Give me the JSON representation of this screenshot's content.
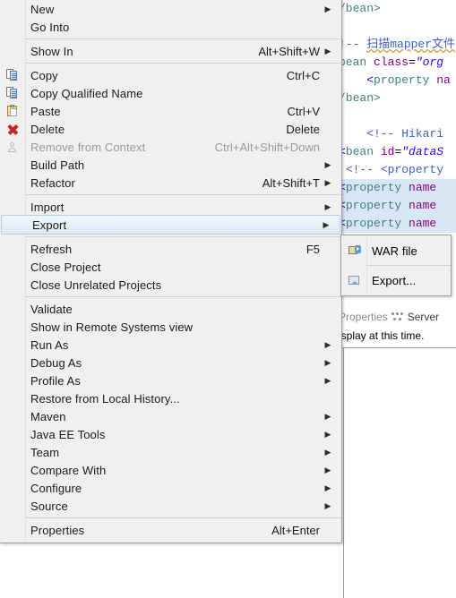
{
  "app": "eclipse-ide",
  "editor": {
    "lines": [
      {
        "selected": false,
        "html": "tag:/bean>"
      },
      {
        "selected": false,
        "html": ""
      },
      {
        "selected": false,
        "html": "cmt:!-- |cjk:扫描mapper文件"
      },
      {
        "selected": false,
        "html": "tag:bean |attr:class|plain:=|val:\"org"
      },
      {
        "selected": false,
        "html": "pad4|br:<|tag:property |attr:na"
      },
      {
        "selected": false,
        "html": "tag:/bean>"
      },
      {
        "selected": false,
        "html": ""
      },
      {
        "selected": false,
        "html": "pad4|cmt:<!-- Hikari "
      },
      {
        "selected": false,
        "html": "br:<|tag:bean |attr:id|plain:=|val:\"dataS"
      },
      {
        "selected": false,
        "html": "pad1|cmt:<!-- <property"
      },
      {
        "selected": true,
        "html": "br:<|tag:property |attr:name"
      },
      {
        "selected": true,
        "html": "br:<|tag:property |attr:name"
      },
      {
        "selected": true,
        "html": "br:<|tag:property |attr:name"
      }
    ],
    "code_text": [
      "/bean>",
      "",
      "!-- 扫描mapper文件",
      "bean class=\"org",
      "    <property na",
      "/bean>",
      "",
      "    <!-- Hikari ",
      "<bean id=\"dataS",
      " <!-- <property",
      "<property name",
      "<property name",
      "<property name"
    ]
  },
  "bottom_panel": {
    "tabs": [
      {
        "label": "Properties",
        "icon": "properties-icon",
        "active": false
      },
      {
        "label": "Server",
        "icon": "servers-icon",
        "active": true
      }
    ],
    "message": "isplay at this time."
  },
  "context_menu": {
    "groups": [
      {
        "items": [
          {
            "label": "New",
            "accel": "",
            "submenu": true,
            "icon": "",
            "disabled": false
          },
          {
            "label": "Go Into",
            "accel": "",
            "submenu": false,
            "icon": "",
            "disabled": false
          }
        ]
      },
      {
        "items": [
          {
            "label": "Show In",
            "accel": "Alt+Shift+W",
            "submenu": true,
            "icon": "",
            "disabled": false
          }
        ]
      },
      {
        "items": [
          {
            "label": "Copy",
            "accel": "Ctrl+C",
            "submenu": false,
            "icon": "copy-icon",
            "disabled": false
          },
          {
            "label": "Copy Qualified Name",
            "accel": "",
            "submenu": false,
            "icon": "copy-icon",
            "disabled": false
          },
          {
            "label": "Paste",
            "accel": "Ctrl+V",
            "submenu": false,
            "icon": "paste-icon",
            "disabled": false
          },
          {
            "label": "Delete",
            "accel": "Delete",
            "submenu": false,
            "icon": "delete-icon",
            "disabled": false
          },
          {
            "label": "Remove from Context",
            "accel": "Ctrl+Alt+Shift+Down",
            "submenu": false,
            "icon": "remove-from-context-icon",
            "disabled": true
          },
          {
            "label": "Build Path",
            "accel": "",
            "submenu": true,
            "icon": "",
            "disabled": false
          },
          {
            "label": "Refactor",
            "accel": "Alt+Shift+T",
            "submenu": true,
            "icon": "",
            "disabled": false
          }
        ]
      },
      {
        "items": [
          {
            "label": "Import",
            "accel": "",
            "submenu": true,
            "icon": "",
            "disabled": false,
            "selected": false
          },
          {
            "label": "Export",
            "accel": "",
            "submenu": true,
            "icon": "",
            "disabled": false,
            "selected": true
          }
        ]
      },
      {
        "items": [
          {
            "label": "Refresh",
            "accel": "F5",
            "submenu": false,
            "icon": "",
            "disabled": false
          },
          {
            "label": "Close Project",
            "accel": "",
            "submenu": false,
            "icon": "",
            "disabled": false
          },
          {
            "label": "Close Unrelated Projects",
            "accel": "",
            "submenu": false,
            "icon": "",
            "disabled": false
          }
        ]
      },
      {
        "items": [
          {
            "label": "Validate",
            "accel": "",
            "submenu": false,
            "icon": "",
            "disabled": false
          },
          {
            "label": "Show in Remote Systems view",
            "accel": "",
            "submenu": false,
            "icon": "",
            "disabled": false
          },
          {
            "label": "Run As",
            "accel": "",
            "submenu": true,
            "icon": "",
            "disabled": false
          },
          {
            "label": "Debug As",
            "accel": "",
            "submenu": true,
            "icon": "",
            "disabled": false
          },
          {
            "label": "Profile As",
            "accel": "",
            "submenu": true,
            "icon": "",
            "disabled": false
          },
          {
            "label": "Restore from Local History...",
            "accel": "",
            "submenu": false,
            "icon": "",
            "disabled": false
          },
          {
            "label": "Maven",
            "accel": "",
            "submenu": true,
            "icon": "",
            "disabled": false
          },
          {
            "label": "Java EE Tools",
            "accel": "",
            "submenu": true,
            "icon": "",
            "disabled": false
          },
          {
            "label": "Team",
            "accel": "",
            "submenu": true,
            "icon": "",
            "disabled": false
          },
          {
            "label": "Compare With",
            "accel": "",
            "submenu": true,
            "icon": "",
            "disabled": false
          },
          {
            "label": "Configure",
            "accel": "",
            "submenu": true,
            "icon": "",
            "disabled": false
          },
          {
            "label": "Source",
            "accel": "",
            "submenu": true,
            "icon": "",
            "disabled": false
          }
        ]
      },
      {
        "items": [
          {
            "label": "Properties",
            "accel": "Alt+Enter",
            "submenu": false,
            "icon": "",
            "disabled": false
          }
        ]
      }
    ]
  },
  "submenu": {
    "parent": "Export",
    "items": [
      {
        "label": "WAR file",
        "icon": "war-file-icon",
        "accel": "",
        "submenu": false
      },
      {
        "label": "Export...",
        "icon": "export-wizard-icon",
        "accel": "",
        "submenu": false
      }
    ]
  },
  "colors": {
    "menu_bg": "#f0f0f0",
    "menu_border": "#a0a0a0",
    "selection_bg": "#e3eef9",
    "selection_border": "#b8cfe5",
    "disabled_text": "#9a9a9a",
    "editor_selection": "#d9e7f5",
    "tag": "#3f7f7f",
    "attr": "#7f007f",
    "value": "#2a00ff",
    "comment": "#3f5fbf",
    "bracket": "#0000c0"
  },
  "glyphs": {
    "submenu_arrow": "▶"
  }
}
